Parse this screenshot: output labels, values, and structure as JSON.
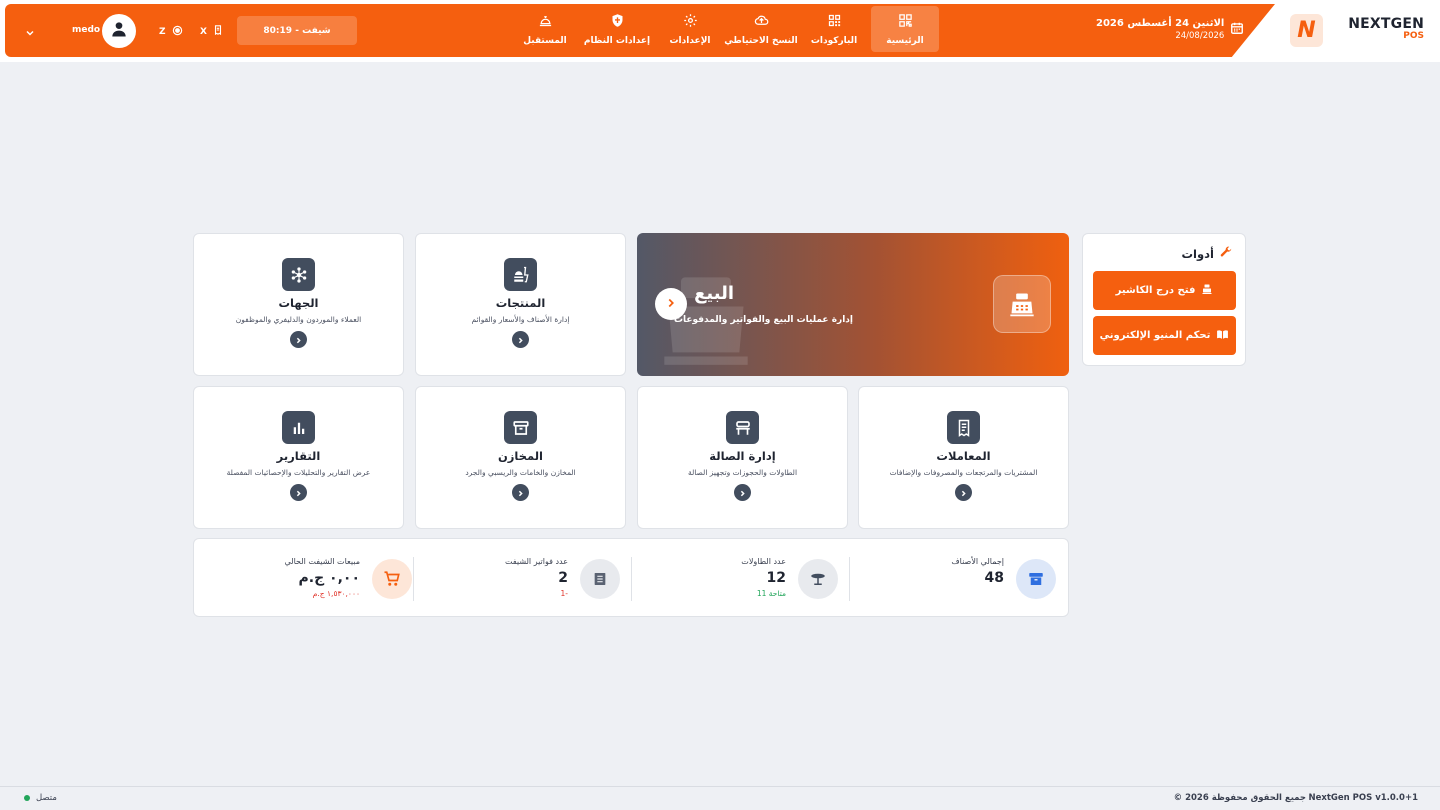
{
  "brand": {
    "name": "NEXTGEN",
    "sub": "POS",
    "logo_letter": "N",
    "accent": "#f55f0f"
  },
  "header": {
    "date_main": "الاثنين 24 أغسطس 2026",
    "date_sub": "24/08/2026",
    "shift": "شيفت - 80:19",
    "x_label": "X",
    "z_label": "Z",
    "user": "medo",
    "nav": [
      {
        "label": "الرئيسية",
        "icon": "grid-icon",
        "active": true
      },
      {
        "label": "الباركودات",
        "icon": "qr-icon"
      },
      {
        "label": "النسخ الاحتياطي",
        "icon": "cloud-upload-icon"
      },
      {
        "label": "الإعدادات",
        "icon": "gear-icon"
      },
      {
        "label": "إعدادات النظام",
        "icon": "shield-icon"
      },
      {
        "label": "المستقبل",
        "icon": "bell-dish-icon"
      }
    ]
  },
  "tools": {
    "title": "أدوات",
    "buttons": [
      {
        "label": "فتح درج الكاشير",
        "icon": "cashier-icon"
      },
      {
        "label": "تحكم المنيو الإلكتروني",
        "icon": "menu-book-icon"
      }
    ]
  },
  "sale": {
    "title": "البيع",
    "desc": "إدارة عمليات البيع والفواتير والمدفوعات"
  },
  "cards": {
    "products": {
      "title": "المنتجات",
      "desc": "إدارة الأصناف والأسعار والقوائم"
    },
    "entities": {
      "title": "الجهات",
      "desc": "العملاء والموردون والدليفري والموظفون"
    },
    "transactions": {
      "title": "المعاملات",
      "desc": "المشتريات والمرتجعات والمصروفات والإضافات"
    },
    "hall": {
      "title": "إدارة الصالة",
      "desc": "الطاولات والحجوزات وتجهيز الصالة"
    },
    "stores": {
      "title": "المخازن",
      "desc": "المخازن والخامات والريسبي والجرد"
    },
    "reports": {
      "title": "التقارير",
      "desc": "عرض التقارير والتحليلات والإحصائيات المفصلة"
    }
  },
  "stats": {
    "items": {
      "label": "إجمالي الأصناف",
      "value": "48"
    },
    "tables": {
      "label": "عدد الطاولات",
      "value": "12",
      "sub": "11 متاحة"
    },
    "invoices": {
      "label": "عدد فواتير الشيفت",
      "value": "2",
      "sub": "1-"
    },
    "sales": {
      "label": "مبيعات الشيفت الحالي",
      "value": "٠,٠٠ ج.م",
      "sub": "١,٥٣٠,٠٠٠ ج.م"
    }
  },
  "footer": {
    "version": "NextGen POS v1.0.0+1",
    "copyright": "© 2026 جميع الحقوق محفوظة",
    "status": "متصل"
  }
}
